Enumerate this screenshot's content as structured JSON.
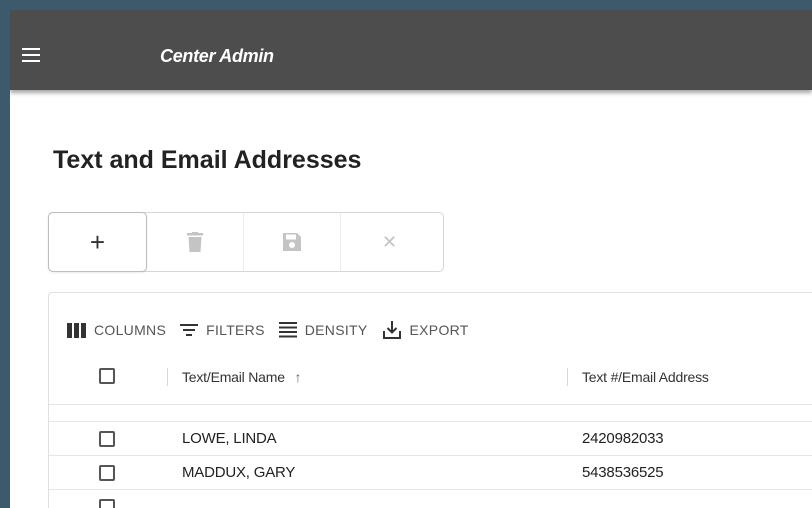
{
  "app": {
    "title": "Center Admin"
  },
  "page": {
    "title": "Text and Email Addresses"
  },
  "toolbar": {
    "buttons": [
      {
        "icon": "add-icon",
        "glyph": "+"
      },
      {
        "icon": "delete-icon"
      },
      {
        "icon": "save-icon"
      },
      {
        "icon": "cancel-icon",
        "glyph": "✕"
      }
    ]
  },
  "grid": {
    "toolbar": {
      "columns_label": "COLUMNS",
      "filters_label": "FILTERS",
      "density_label": "DENSITY",
      "export_label": "EXPORT"
    },
    "columns": [
      {
        "label": "Text/Email Name",
        "sort": "↑"
      },
      {
        "label": "Text #/Email Address"
      }
    ],
    "rows": [
      {
        "name": "LOWE, LINDA",
        "address": "2420982033"
      },
      {
        "name": "MADDUX, GARY",
        "address": "5438536525"
      }
    ]
  },
  "colors": {
    "appbar": "#4d4d4d",
    "frame": "#3c5a6b",
    "disabled_icon": "#c4c4c4"
  }
}
